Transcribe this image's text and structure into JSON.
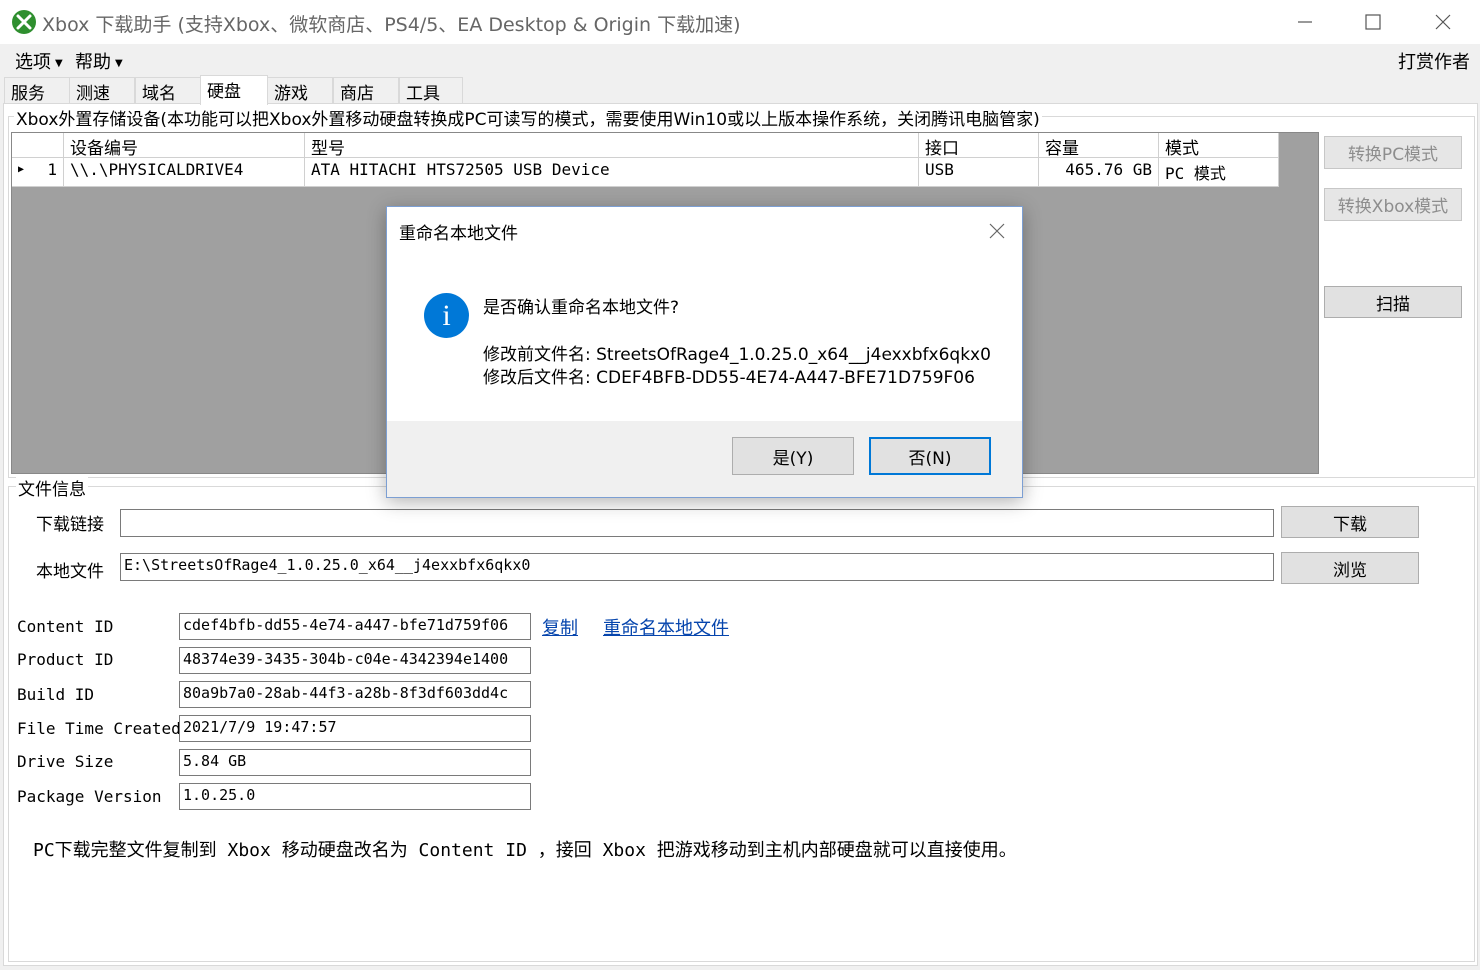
{
  "window": {
    "title": "Xbox 下载助手 (支持Xbox、微软商店、PS4/5、EA Desktop & Origin 下载加速)"
  },
  "menu": {
    "options": "选项",
    "help": "帮助",
    "reward_author": "打赏作者"
  },
  "tabs": [
    "服务",
    "测速",
    "域名",
    "硬盘",
    "游戏",
    "商店",
    "工具"
  ],
  "active_tab": "硬盘",
  "storage": {
    "group_title": "Xbox外置存储设备(本功能可以把Xbox外置移动硬盘转换成PC可读写的模式，需要使用Win10或以上版本操作系统，关闭腾讯电脑管家)",
    "columns": [
      "设备编号",
      "型号",
      "接口",
      "容量",
      "模式"
    ],
    "rows": [
      {
        "index": "1",
        "device": "\\\\.\\PHYSICALDRIVE4",
        "model": "ATA HITACHI HTS72505 USB Device",
        "interface": "USB",
        "capacity": "465.76 GB",
        "mode": "PC 模式"
      }
    ],
    "btn_to_pc": "转换PC模式",
    "btn_to_xbox": "转换Xbox模式",
    "btn_scan": "扫描"
  },
  "file_info": {
    "group_title": "文件信息",
    "download_link_label": "下载链接",
    "download_link_value": "",
    "download_btn": "下载",
    "local_file_label": "本地文件",
    "local_file_value": "E:\\StreetsOfRage4_1.0.25.0_x64__j4exxbfx6qkx0",
    "browse_btn": "浏览",
    "fields": [
      {
        "label": "Content ID",
        "value": "cdef4bfb-dd55-4e74-a447-bfe71d759f06"
      },
      {
        "label": "Product ID",
        "value": "48374e39-3435-304b-c04e-4342394e1400"
      },
      {
        "label": "Build ID",
        "value": "80a9b7a0-28ab-44f3-a28b-8f3df603dd4c"
      },
      {
        "label": "File Time Created",
        "value": "2021/7/9 19:47:57"
      },
      {
        "label": "Drive Size",
        "value": "5.84 GB"
      },
      {
        "label": "Package Version",
        "value": "1.0.25.0"
      }
    ],
    "copy_link": "复制",
    "rename_link": "重命名本地文件",
    "note": "PC下载完整文件复制到 Xbox 移动硬盘改名为 Content ID ，接回 Xbox 把游戏移动到主机内部硬盘就可以直接使用。"
  },
  "dialog": {
    "title": "重命名本地文件",
    "question": "是否确认重命名本地文件?",
    "before_label": "修改前文件名:",
    "before_value": "StreetsOfRage4_1.0.25.0_x64__j4exxbfx6qkx0",
    "after_label": "修改后文件名:",
    "after_value": "CDEF4BFB-DD55-4E74-A447-BFE71D759F06",
    "yes": "是(Y)",
    "no": "否(N)",
    "info_glyph": "i"
  },
  "colors": {
    "accent": "#0078d7",
    "xbox_green": "#2f8f2f",
    "link": "#0645ad",
    "grid_background": "#a0a0a0"
  }
}
